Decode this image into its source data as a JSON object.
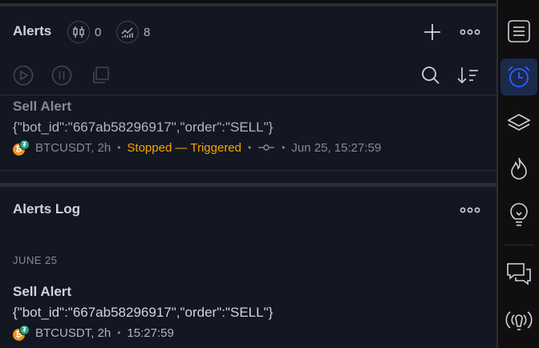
{
  "alerts_panel": {
    "title": "Alerts",
    "counters": [
      {
        "icon": "candlestick-icon",
        "value": "0"
      },
      {
        "icon": "chart-line-icon",
        "value": "8"
      }
    ],
    "toolbar": {
      "play_icon": "play-icon",
      "pause_icon": "pause-icon",
      "clone_icon": "clone-icon",
      "search_icon": "search-icon",
      "sort_icon": "sort-icon"
    },
    "items": [
      {
        "name": "Sell Alert",
        "message": "{\"bot_id\":\"667ab58296917\",\"order\":\"SELL\"}",
        "symbol": "BTCUSDT, 2h",
        "status": "Stopped — Triggered",
        "condition_icon": "crossing-icon",
        "datetime": "Jun 25, 15:27:59"
      }
    ]
  },
  "log_panel": {
    "title": "Alerts Log",
    "date_group": "JUNE 25",
    "items": [
      {
        "name": "Sell Alert",
        "message": "{\"bot_id\":\"667ab58296917\",\"order\":\"SELL\"}",
        "symbol": "BTCUSDT, 2h",
        "time": "15:27:59"
      }
    ]
  },
  "coin_badges": {
    "base": "₿",
    "quote": "₮"
  },
  "colors": {
    "accent": "#2962ff",
    "status_triggered": "#f7a600",
    "panel_bg": "#131722",
    "usdt": "#26a17b",
    "btc": "#f7931a"
  },
  "sidebar": {
    "items": [
      "watchlist-icon",
      "alarm-clock-icon",
      "layers-icon",
      "hotlist-flame-icon",
      "ideas-bulb-icon",
      "chat-icon",
      "signal-broadcast-icon"
    ],
    "active": "alarm-clock-icon"
  }
}
